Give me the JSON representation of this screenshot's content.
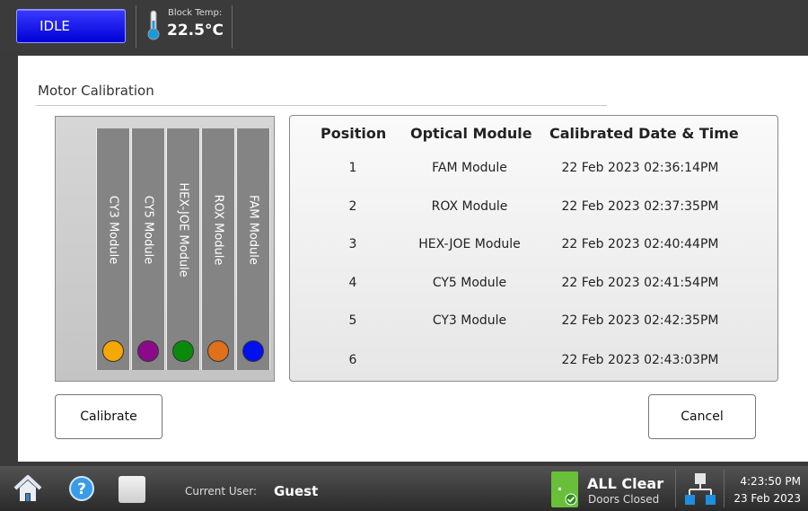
{
  "status_bar": {
    "state_label": "IDLE",
    "temp_label": "Block Temp:",
    "temp_value": "22.5°C"
  },
  "page": {
    "title": "Motor Calibration"
  },
  "modules": [
    {
      "label": "CY3 Module",
      "color": "#f5a800"
    },
    {
      "label": "CY5 Module",
      "color": "#8a0a8a"
    },
    {
      "label": "HEX-JOE Module",
      "color": "#0a8a0a"
    },
    {
      "label": "ROX Module",
      "color": "#e0701a"
    },
    {
      "label": "FAM Module",
      "color": "#0010ee"
    }
  ],
  "table": {
    "headers": [
      "Position",
      "Optical Module",
      "Calibrated Date & Time"
    ],
    "rows": [
      {
        "position": "1",
        "module": "FAM Module",
        "datetime": "22 Feb 2023 02:36:14PM"
      },
      {
        "position": "2",
        "module": "ROX Module",
        "datetime": "22 Feb 2023 02:37:35PM"
      },
      {
        "position": "3",
        "module": "HEX-JOE Module",
        "datetime": "22 Feb 2023 02:40:44PM"
      },
      {
        "position": "4",
        "module": "CY5 Module",
        "datetime": "22 Feb 2023 02:41:54PM"
      },
      {
        "position": "5",
        "module": "CY3 Module",
        "datetime": "22 Feb 2023 02:42:35PM"
      },
      {
        "position": "6",
        "module": "",
        "datetime": "22 Feb 2023 02:43:03PM"
      }
    ]
  },
  "buttons": {
    "calibrate": "Calibrate",
    "cancel": "Cancel"
  },
  "bottom_bar": {
    "user_label": "Current User:",
    "user_value": "Guest",
    "status_main": "ALL Clear",
    "status_sub": "Doors Closed",
    "time": "4:23:50 PM",
    "date": "23 Feb 2023",
    "icons": [
      "home-icon",
      "help-icon",
      "blank-tile-icon",
      "door-status-icon",
      "network-icon"
    ]
  }
}
